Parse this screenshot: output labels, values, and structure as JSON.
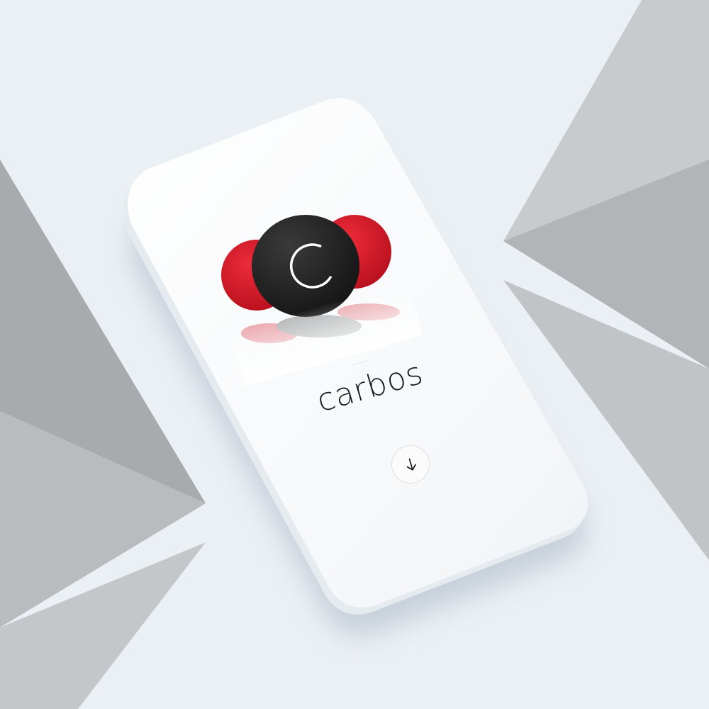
{
  "app": {
    "brand_name": "carbos",
    "logo_letter": "C"
  },
  "screen": {
    "scroll_down_icon": "arrow-down-icon"
  },
  "colors": {
    "background": "#ebf0f4",
    "accent_red": "#d11a2a",
    "logo_dark": "#232323",
    "phone_body": "#ffffff"
  }
}
